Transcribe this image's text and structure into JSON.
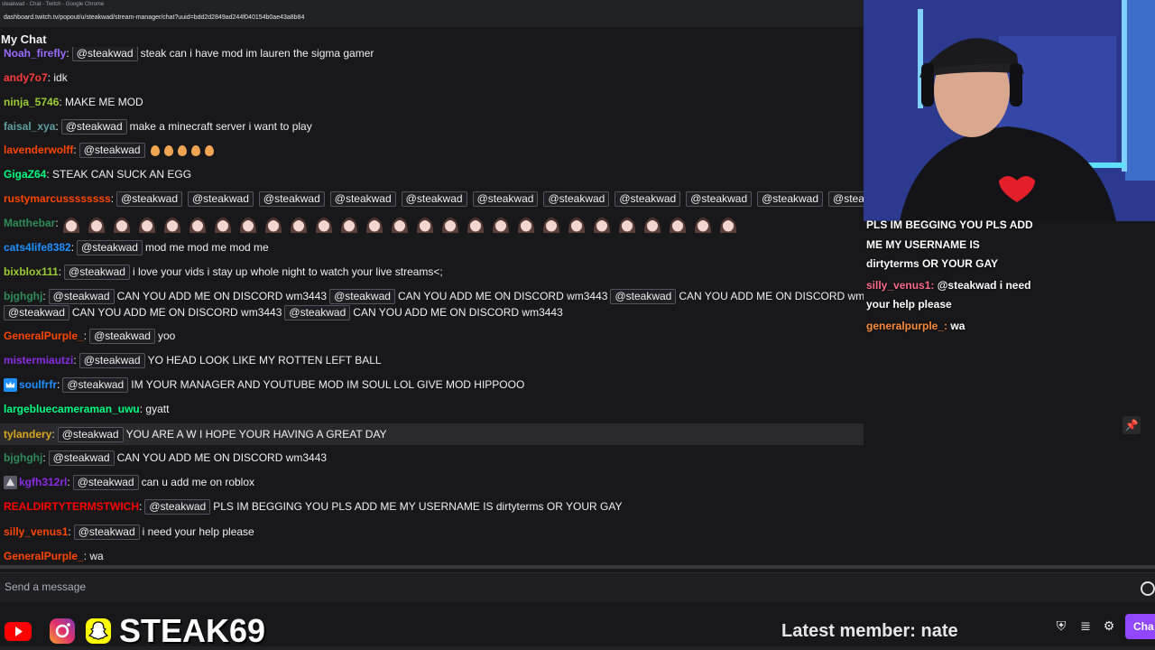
{
  "window": {
    "title": "steakwad - Chat - Twitch - Google Chrome",
    "url": "dashboard.twitch.tv/popout/u/steakwad/stream-manager/chat?uuid=bdd2d2849ad244f040154b0ae43a8b84"
  },
  "chat": {
    "header": "My Chat",
    "mention": "@steakwad",
    "messages": [
      {
        "user": "Noah_firefly",
        "color": "#9b6bff",
        "text": "steak can i have mod im lauren the sigma gamer"
      },
      {
        "user": "andy7o7",
        "color": "#ff3b3b",
        "text": "idk"
      },
      {
        "user": "ninja_5746",
        "color": "#9acd32",
        "text": "MAKE ME MOD"
      },
      {
        "user": "faisal_xya",
        "color": "#5f9ea0",
        "text": "make a minecraft server i want to play"
      },
      {
        "user": "lavenderwolff",
        "color": "#ff4500",
        "text": ""
      },
      {
        "user": "GigaZ64",
        "color": "#00ff7f",
        "text": "STEAK CAN SUCK AN EGG"
      },
      {
        "user": "rustymarcussssssss",
        "color": "#ff4500",
        "text": ""
      },
      {
        "user": "Matthebar",
        "color": "#2e8b57",
        "text": ""
      },
      {
        "user": "cats4life8382",
        "color": "#1e90ff",
        "text": "mod me mod me mod me"
      },
      {
        "user": "bixblox111",
        "color": "#9acd32",
        "text": "i love your vids i stay up whole night to watch your live streams<;"
      },
      {
        "user": "bjghghj",
        "color": "#2e8b57",
        "text": "CAN YOU ADD ME ON DISCORD wm3443"
      },
      {
        "user": "GeneralPurple_",
        "color": "#ff4500",
        "text": "yoo"
      },
      {
        "user": "mistermiautzi",
        "color": "#8a2be2",
        "text": "YO HEAD LOOK LIKE MY ROTTEN LEFT BALL"
      },
      {
        "user": "soulfrfr",
        "color": "#1e90ff",
        "text": "IM YOUR MANAGER AND YOUTUBE MOD IM SOUL LOL GIVE MOD HIPPOOO"
      },
      {
        "user": "largebluecameraman_uwu",
        "color": "#00ff7f",
        "text": "gyatt"
      },
      {
        "user": "tylandery",
        "color": "#daa520",
        "text": "YOU ARE A W I HOPE YOUR HAVING A GREAT DAY"
      },
      {
        "user": "bjghghj",
        "color": "#2e8b57",
        "text": "CAN YOU ADD ME ON DISCORD wm3443"
      },
      {
        "user": "kgfh312rl",
        "color": "#8a2be2",
        "text": "can u add me on roblox"
      },
      {
        "user": "REALDIRTYTERMSTWICH",
        "color": "#ff0000",
        "text": "PLS IM BEGGING YOU PLS ADD ME MY USERNAME IS dirtyterms OR YOUR GAY"
      },
      {
        "user": "silly_venus1",
        "color": "#ff4500",
        "text": "i need your help please"
      },
      {
        "user": "GeneralPurple_",
        "color": "#ff4500",
        "text": "wa"
      }
    ],
    "input_placeholder": "Send a message"
  },
  "overlay": {
    "lines": [
      "PLS IM BEGGING YOU PLS ADD",
      "ME MY USERNAME IS",
      "dirtyterms OR YOUR GAY"
    ],
    "silly_user": "silly_venus1:",
    "silly_text": "@steakwad i need",
    "silly_text2": "your help please",
    "gp_user": "generalpurple_:",
    "gp_text": "wa"
  },
  "stream": {
    "brand": "STEAK69",
    "latest_member": "Latest member: nate",
    "chat_button": "Cha"
  },
  "colors": {
    "background": "#18181b",
    "accent": "#9147ff"
  }
}
